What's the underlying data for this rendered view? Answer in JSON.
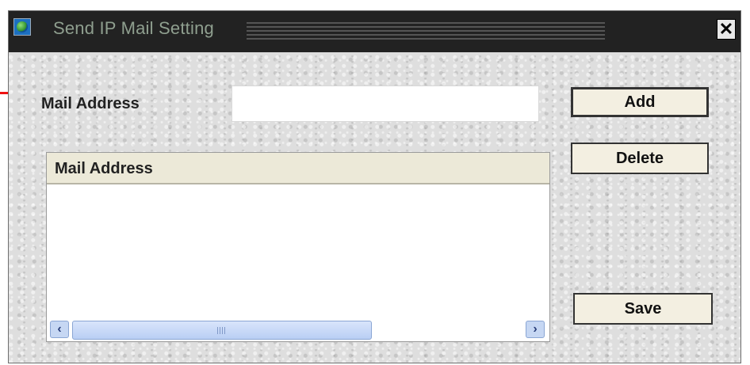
{
  "window": {
    "title": "Send IP Mail Setting",
    "close_glyph": "✕"
  },
  "form": {
    "mail_label": "Mail Address",
    "mail_value": "",
    "mail_placeholder": ""
  },
  "buttons": {
    "add": "Add",
    "delete": "Delete",
    "save": "Save"
  },
  "list": {
    "columns": [
      "Mail Address"
    ],
    "rows": []
  },
  "scrollbar": {
    "left_arrow": "‹",
    "right_arrow": "›"
  },
  "icons": {
    "app": "globe-app-icon",
    "close": "close-icon"
  },
  "colors": {
    "titlebar": "#222222",
    "title_text": "#8f9f8f",
    "annotation_line": "#ee1111",
    "button_face": "#f3efe1",
    "scrollbar": "#c6d7f3"
  }
}
